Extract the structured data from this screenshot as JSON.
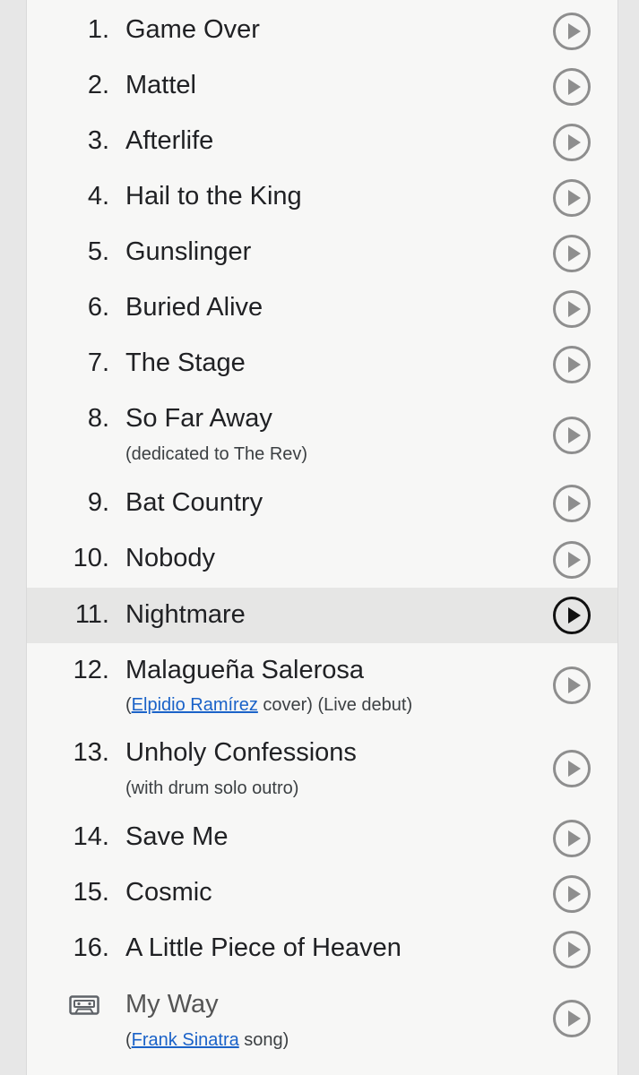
{
  "tracks": [
    {
      "num": "1.",
      "title": "Game Over"
    },
    {
      "num": "2.",
      "title": "Mattel"
    },
    {
      "num": "3.",
      "title": "Afterlife"
    },
    {
      "num": "4.",
      "title": "Hail to the King"
    },
    {
      "num": "5.",
      "title": "Gunslinger"
    },
    {
      "num": "6.",
      "title": "Buried Alive"
    },
    {
      "num": "7.",
      "title": "The Stage"
    },
    {
      "num": "8.",
      "title": "So Far Away",
      "note": "(dedicated to The Rev)"
    },
    {
      "num": "9.",
      "title": "Bat Country"
    },
    {
      "num": "10.",
      "title": "Nobody"
    },
    {
      "num": "11.",
      "title": "Nightmare"
    },
    {
      "num": "12.",
      "title": "Malagueña Salerosa",
      "note_pre": "(",
      "note_link": "Elpidio Ramírez",
      "note_post": " cover) (Live debut)"
    },
    {
      "num": "13.",
      "title": "Unholy Confessions",
      "note": "(with drum solo outro)"
    },
    {
      "num": "14.",
      "title": "Save Me"
    },
    {
      "num": "15.",
      "title": "Cosmic"
    },
    {
      "num": "16.",
      "title": "A Little Piece of Heaven"
    },
    {
      "title": "My Way",
      "note_pre": "(",
      "note_link": "Frank Sinatra",
      "note_post": " song)"
    }
  ],
  "icons": {
    "play": "play-button-icon",
    "tape": "cassette-tape-icon"
  },
  "colors": {
    "link": "#1a62c8",
    "active_row": "#e6e6e5",
    "play_inactive": "#8e8e8e",
    "play_active": "#111111"
  },
  "active_track": "11."
}
